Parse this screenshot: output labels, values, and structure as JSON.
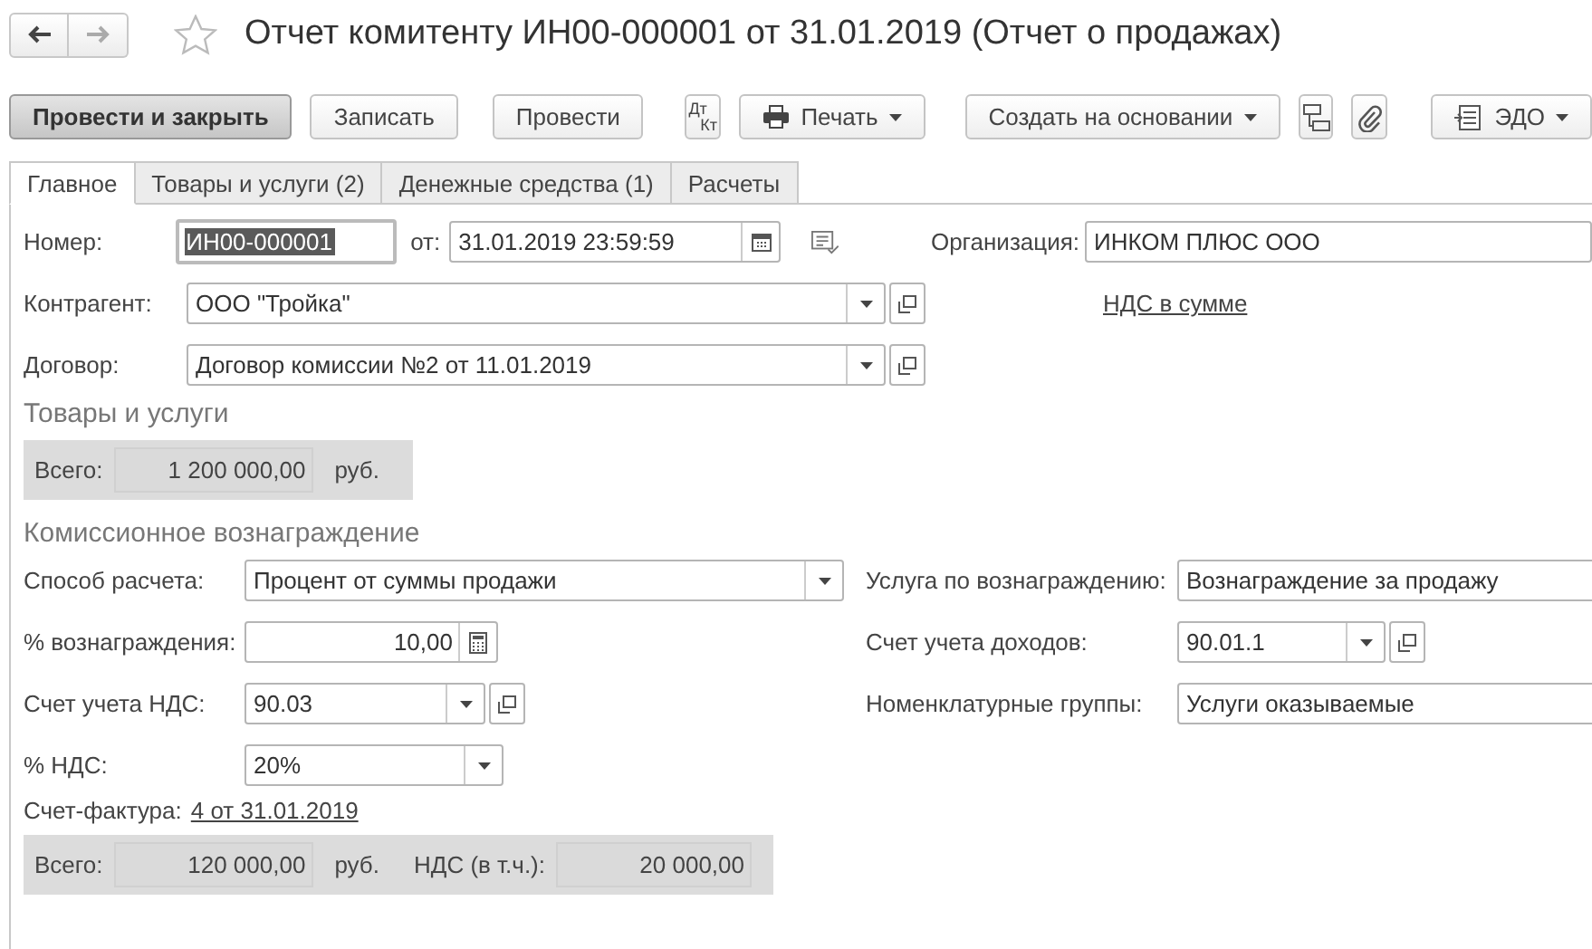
{
  "nav": [
    {
      "kind": "back",
      "disabled": false
    },
    {
      "kind": "forward",
      "disabled": true
    }
  ],
  "favorite": false,
  "title": "Отчет комитенту ИН00-000001 от 31.01.2019 (Отчет о продажах)",
  "toolbar": [
    {
      "kind": "primary",
      "label": "Провести и закрыть"
    },
    {
      "kind": "button",
      "label": "Записать"
    },
    {
      "kind": "button",
      "label": "Провести"
    },
    {
      "kind": "dtkt",
      "top": "Дт",
      "bottom": "Кт"
    },
    {
      "kind": "print",
      "label": "Печать"
    },
    {
      "kind": "menu",
      "label": "Создать на основании"
    },
    {
      "kind": "structure"
    },
    {
      "kind": "attach"
    },
    {
      "kind": "edo",
      "label": "ЭДО"
    }
  ],
  "tabs": [
    {
      "label": "Главное",
      "selected": true
    },
    {
      "label": "Товары и услуги (2)",
      "selected": false
    },
    {
      "label": "Денежные средства (1)",
      "selected": false
    },
    {
      "label": "Расчеты",
      "selected": false
    }
  ],
  "header": {
    "number": {
      "label": "Номер:",
      "value": "ИН00-000001",
      "focused": true
    },
    "date": {
      "label": "от:",
      "value": "31.01.2019 23:59:59"
    },
    "organization": {
      "label": "Организация:",
      "value": "ИНКОМ ПЛЮС ООО"
    },
    "counterparty": {
      "label": "Контрагент:",
      "value": "ООО \"Тройка\""
    },
    "vat_link": "НДС в сумме",
    "contract": {
      "label": "Договор:",
      "value": "Договор комиссии №2 от 11.01.2019"
    }
  },
  "goods": {
    "title": "Товары и услуги",
    "total_label": "Всего:",
    "total": "1 200 000,00",
    "currency": "руб."
  },
  "commission": {
    "title": "Комиссионное вознаграждение",
    "left": [
      {
        "kind": "select",
        "label": "Способ расчета:",
        "value": "Процент от суммы продажи",
        "open_button": false
      },
      {
        "kind": "number",
        "label": "% вознаграждения:",
        "value": "10,00"
      },
      {
        "kind": "select",
        "label": "Счет учета НДС:",
        "value": "90.03",
        "open_button": true
      },
      {
        "kind": "select",
        "label": "% НДС:",
        "value": "20%",
        "open_button": false
      }
    ],
    "right": [
      {
        "kind": "text",
        "label": "Услуга по вознаграждению:",
        "value": "Вознаграждение за продажу"
      },
      {
        "kind": "select",
        "label": "Счет учета доходов:",
        "value": "90.01.1",
        "open_button": true
      },
      {
        "kind": "text",
        "label": "Номенклатурные группы:",
        "value": "Услуги оказываемые"
      }
    ],
    "invoice": {
      "label": "Счет-фактура:",
      "link": "4 от 31.01.2019"
    },
    "totals": {
      "total_label": "Всего:",
      "total": "120 000,00",
      "currency": "руб.",
      "vat_label": "НДС (в т.ч.):",
      "vat": "20 000,00"
    }
  }
}
